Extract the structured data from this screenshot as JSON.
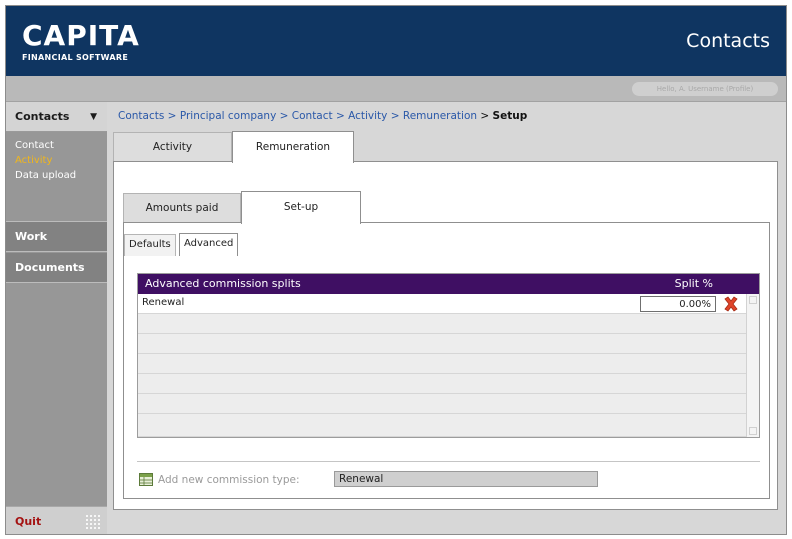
{
  "header": {
    "logo_name": "CAPITA",
    "logo_sub": "FINANCIAL SOFTWARE",
    "page_heading": "Contacts",
    "user_info": "Hello, A. Username (Profile)"
  },
  "sidebar": {
    "sections": [
      {
        "label": "Contacts"
      },
      {
        "label": "Work"
      },
      {
        "label": "Documents"
      }
    ],
    "contacts_items": [
      {
        "label": "Contact"
      },
      {
        "label": "Activity"
      },
      {
        "label": "Data upload"
      }
    ],
    "quit_label": "Quit"
  },
  "breadcrumb": {
    "links": [
      "Contacts",
      "Principal company",
      "Contact",
      "Activity",
      "Remuneration"
    ],
    "separator": ">",
    "current": "Setup"
  },
  "tabs": [
    {
      "label": "Activity"
    },
    {
      "label": "Remuneration"
    }
  ],
  "sub_tabs": [
    {
      "label": "Amounts paid"
    },
    {
      "label": "Set-up"
    }
  ],
  "inner_tabs": [
    {
      "label": "Defaults"
    },
    {
      "label": "Advanced"
    }
  ],
  "grid": {
    "header_name": "Advanced commission splits",
    "header_split": "Split %",
    "rows": [
      {
        "name": "Renewal",
        "split": "0.00%"
      }
    ]
  },
  "add_commission": {
    "label": "Add new commission type:",
    "selected_value": "Renewal"
  },
  "colors": {
    "header_bg": "#0f3561",
    "grid_header_bg": "#3f0f63",
    "active_nav_item": "#f0b61c",
    "quit_text": "#a41212",
    "breadcrumb_link": "#2a58a8",
    "delete_icon": "#e0442a"
  },
  "icons": {
    "nav_caret": "caret-down-icon",
    "delete": "red-x-delete-icon",
    "add": "add-grid-icon",
    "grip": "grip-dots-icon"
  }
}
